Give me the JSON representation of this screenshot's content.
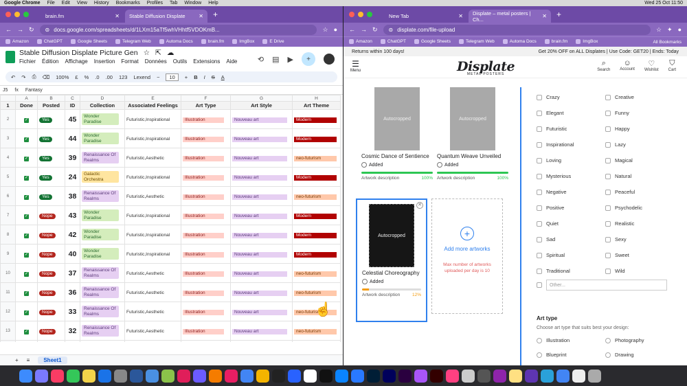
{
  "menubar": {
    "app": "Google Chrome",
    "items": [
      "File",
      "Edit",
      "View",
      "History",
      "Bookmarks",
      "Profiles",
      "Tab",
      "Window",
      "Help"
    ],
    "clock": "Wed 25 Oct 11:50"
  },
  "left": {
    "tabs": [
      {
        "label": "brain.fm"
      },
      {
        "label": "Stable Diffusion Displate"
      }
    ],
    "url": "docs.google.com/spreadsheets/d/1LXm15aTf5whVHhtf5VDOKmB...",
    "bookmarks": [
      "Amazon",
      "ChatGPT",
      "Google Sheets",
      "Telegram Web",
      "Automa Docs",
      "brain.fm",
      "ImgBox",
      "E Drive"
    ],
    "title": "Stable Diffusion Displate Picture Gen",
    "menus": [
      "Fichier",
      "Édition",
      "Affichage",
      "Insertion",
      "Format",
      "Données",
      "Outils",
      "Extensions",
      "Aide"
    ],
    "toolbar": {
      "zoom": "100%",
      "currency": "£",
      "percent": "%",
      "dec1": ".0",
      "dec2": ".00",
      "numfmt": "123",
      "font": "Lexend",
      "size": "10"
    },
    "cellref": "J5",
    "formula": "Fantasy",
    "cols": [
      "A",
      "B",
      "C",
      "D",
      "E",
      "F",
      "G",
      "H"
    ],
    "headers": [
      "Done",
      "Posted",
      "ID",
      "Collection",
      "Associated Feelings",
      "Art Type",
      "Art Style",
      "Art Theme"
    ],
    "rows": [
      {
        "n": "2",
        "posted": "Yes",
        "id": "45",
        "coll": "Wonder Paradise",
        "cc": "green",
        "feel": "Futuristic,Inspirational",
        "type": "Illustration",
        "style": "Nouveau art",
        "theme": "Modern"
      },
      {
        "n": "3",
        "posted": "Yes",
        "id": "44",
        "coll": "Wonder Paradise",
        "cc": "green",
        "feel": "Futuristic,Inspirational",
        "type": "Illustration",
        "style": "Nouveau art",
        "theme": "Modern"
      },
      {
        "n": "4",
        "posted": "Yes",
        "id": "39",
        "coll": "Renaissance Of Realms",
        "cc": "purple",
        "feel": "Futuristic,Aesthetic",
        "type": "Illustration",
        "style": "Nouveau art",
        "theme": "neo-futurism"
      },
      {
        "n": "5",
        "posted": "Yes",
        "id": "24",
        "coll": "Galactic Orchestra",
        "cc": "yellow",
        "feel": "Futuristic,Inspirational",
        "type": "Illustration",
        "style": "Nouveau art",
        "theme": "Modern"
      },
      {
        "n": "6",
        "posted": "Yes",
        "id": "38",
        "coll": "Renaissance Of Realms",
        "cc": "purple",
        "feel": "Futuristic,Aesthetic",
        "type": "Illustration",
        "style": "Nouveau art",
        "theme": "neo-futurism"
      },
      {
        "n": "7",
        "posted": "Nope",
        "id": "43",
        "coll": "Wonder Paradise",
        "cc": "green",
        "feel": "Futuristic,Inspirational",
        "type": "Illustration",
        "style": "Nouveau art",
        "theme": "Modern"
      },
      {
        "n": "8",
        "posted": "Nope",
        "id": "42",
        "coll": "Wonder Paradise",
        "cc": "green",
        "feel": "Futuristic,Inspirational",
        "type": "Illustration",
        "style": "Nouveau art",
        "theme": "Modern"
      },
      {
        "n": "9",
        "posted": "Nope",
        "id": "40",
        "coll": "Wonder Paradise",
        "cc": "green",
        "feel": "Futuristic,Inspirational",
        "type": "Illustration",
        "style": "Nouveau art",
        "theme": "Modern"
      },
      {
        "n": "10",
        "posted": "Nope",
        "id": "37",
        "coll": "Renaissance Of Realms",
        "cc": "purple",
        "feel": "Futuristic,Aesthetic",
        "type": "Illustration",
        "style": "Nouveau art",
        "theme": "neo-futurism"
      },
      {
        "n": "11",
        "posted": "Nope",
        "id": "36",
        "coll": "Renaissance Of Realms",
        "cc": "purple",
        "feel": "Futuristic,Aesthetic",
        "type": "Illustration",
        "style": "Nouveau art",
        "theme": "neo-futurism"
      },
      {
        "n": "12",
        "posted": "Nope",
        "id": "33",
        "coll": "Renaissance Of Realms",
        "cc": "purple",
        "feel": "Futuristic,Aesthetic",
        "type": "Illustration",
        "style": "Nouveau art",
        "theme": "neo-futurism"
      },
      {
        "n": "13",
        "posted": "Nope",
        "id": "32",
        "coll": "Renaissance Of Realms",
        "cc": "purple",
        "feel": "Futuristic,Aesthetic",
        "type": "Illustration",
        "style": "Nouveau art",
        "theme": "neo-futurism"
      },
      {
        "n": "14",
        "posted": "Nope",
        "id": "31",
        "coll": "",
        "cc": "purple",
        "feel": "",
        "type": "Illustration",
        "style": "Nouveau art",
        "theme": "neo-futurism"
      }
    ],
    "sheet_tab": "Sheet1"
  },
  "right": {
    "tabs": [
      {
        "label": "New Tab"
      },
      {
        "label": "Displate – metal posters | Ch..."
      }
    ],
    "url": "displate.com/file-upload",
    "bookmarks": [
      "Amazon",
      "ChatGPT",
      "Google Sheets",
      "Telegram Web",
      "Automa Docs",
      "brain.fm",
      "ImgBox"
    ],
    "all_bookmarks": "All Bookmarks",
    "promo_left": "Returns within 100 days!",
    "promo_right": "Get 20% OFF on ALL Displates | Use Code: GET20 | Ends: Today",
    "menu_label": "Menu",
    "logo": "Displate",
    "logo_sub": "METAL POSTERS",
    "icons": [
      "Search",
      "Account",
      "Wishlist",
      "Cart"
    ],
    "cards": [
      {
        "title": "Cosmic Dance of Sentience",
        "added": "Added",
        "desc": "Artwork description",
        "pct": "100%",
        "progress": 1.0,
        "thumb": "Autocropped"
      },
      {
        "title": "Quantum Weave Unveiled",
        "added": "Added",
        "desc": "Artwork description",
        "pct": "100%",
        "progress": 1.0,
        "thumb": "Autocropped"
      }
    ],
    "selected": {
      "title": "Celestial Choreography",
      "added": "Added",
      "desc": "Artwork description",
      "pct": "12%",
      "progress": 0.12,
      "thumb": "Autocropped"
    },
    "add_more": "Add more artworks",
    "max_note": "Max number of artworks uploaded per day is 10",
    "tags": [
      "Crazy",
      "Creative",
      "Elegant",
      "Funny",
      "Futuristic",
      "Happy",
      "Inspirational",
      "Lazy",
      "Loving",
      "Magical",
      "Mysterious",
      "Natural",
      "Negative",
      "Peaceful",
      "Positive",
      "Psychodelic",
      "Quiet",
      "Realistic",
      "Sad",
      "Sexy",
      "Spiritual",
      "Sweet",
      "Traditional",
      "Wild"
    ],
    "other_placeholder": "Other...",
    "art_type_title": "Art type",
    "art_type_help": "Choose art type that suits best your design:",
    "art_types": [
      "Illustration",
      "Photography",
      "Blueprint",
      "Drawing"
    ]
  },
  "colors": {
    "chrome": "#6d4aa6",
    "accent": "#2f80ed",
    "sheets_green": "#0f9d58"
  }
}
